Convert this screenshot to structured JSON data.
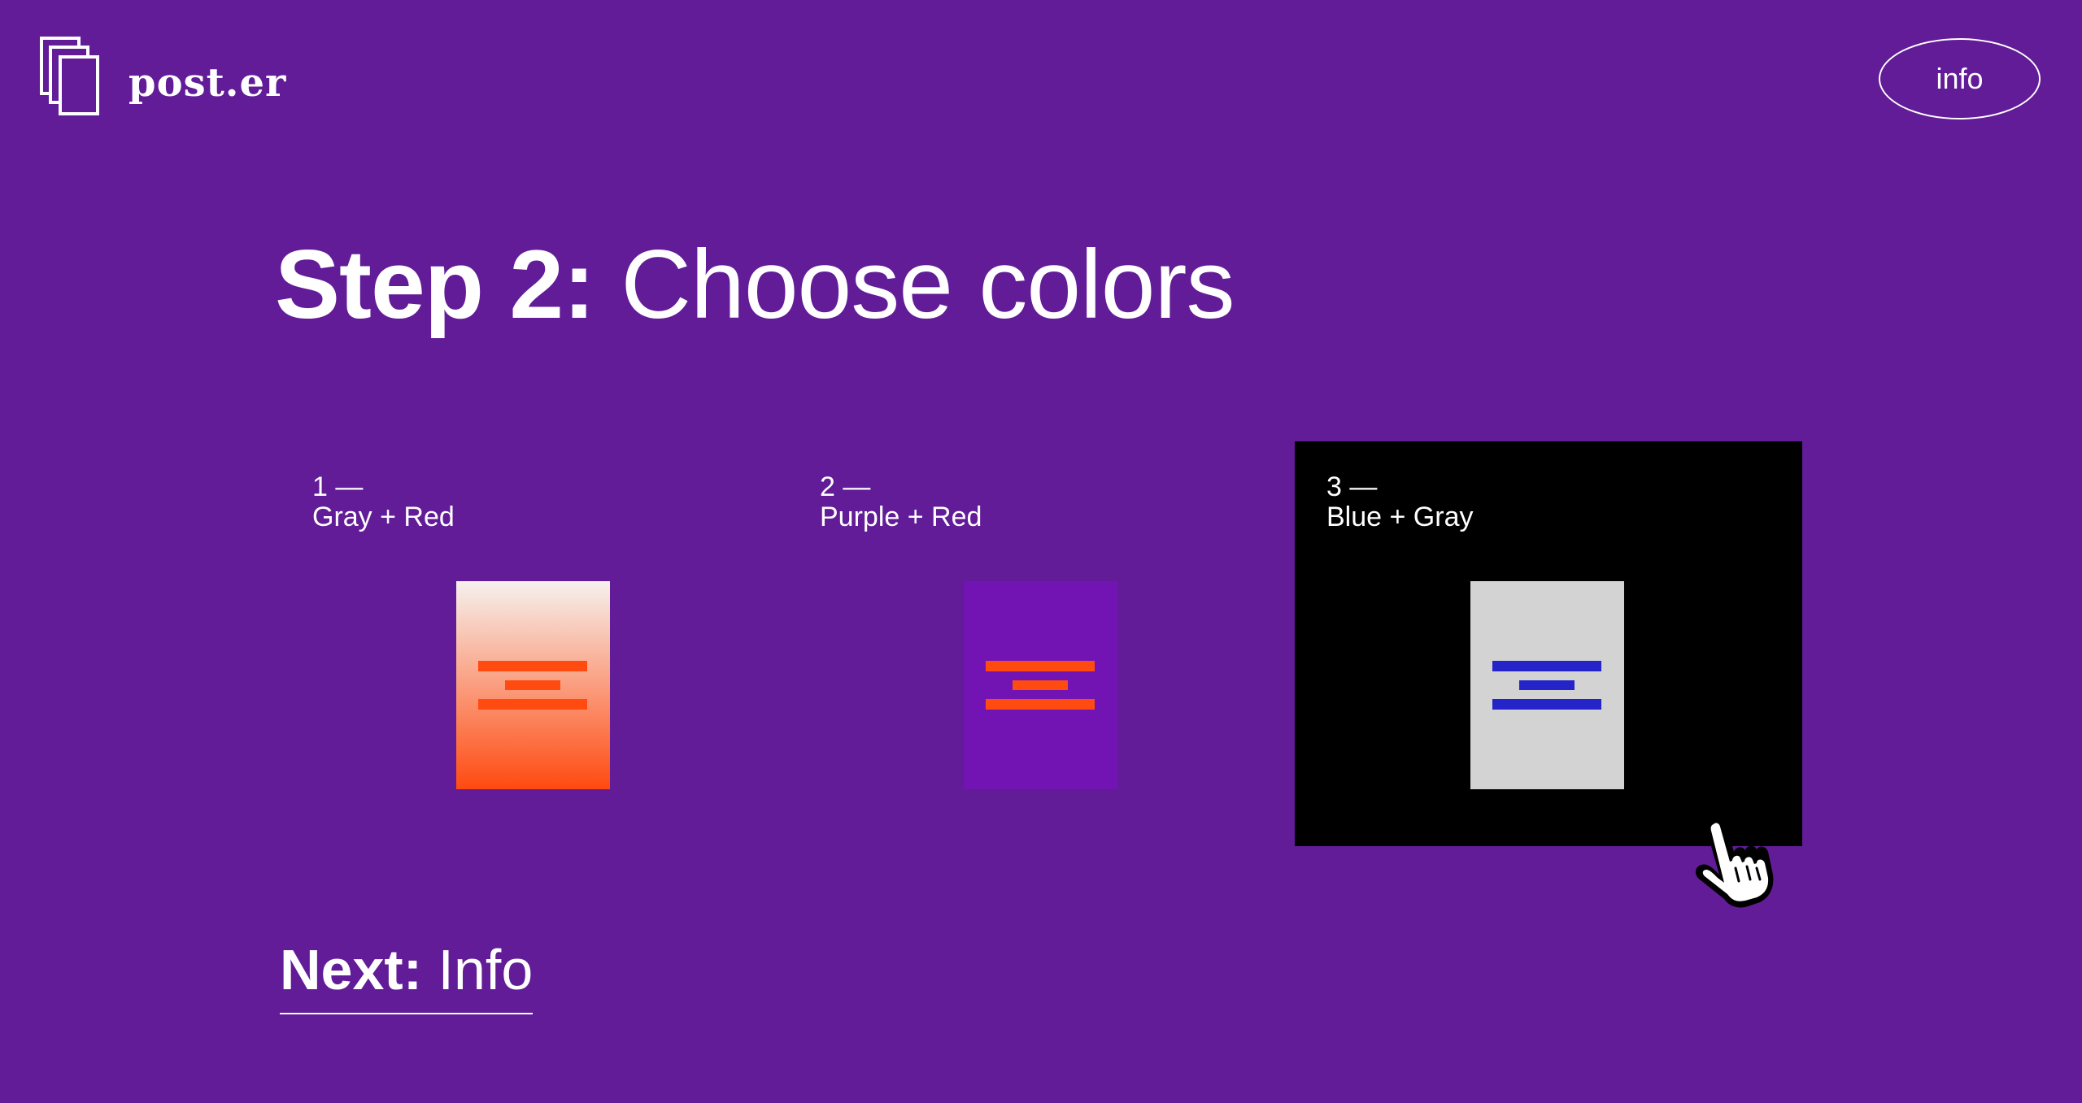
{
  "header": {
    "logo_text": "post.er",
    "info_label": "info"
  },
  "step": {
    "prefix": "Step 2:",
    "title": "Choose colors"
  },
  "options": [
    {
      "number": "1 —",
      "name": "Gray + Red",
      "selected": false,
      "poster_bg": "linear-gradient(#f6f1ee, #ff4a10)",
      "bar_color": "#ff4a10"
    },
    {
      "number": "2 —",
      "name": "Purple + Red",
      "selected": false,
      "poster_bg": "#7214b4",
      "bar_color": "#ff4a10"
    },
    {
      "number": "3 —",
      "name": "Blue + Gray",
      "selected": true,
      "poster_bg": "#d3d3d3",
      "bar_color": "#2424c9"
    }
  ],
  "next": {
    "prefix": "Next:",
    "label": "Info"
  },
  "colors": {
    "background": "#621c97",
    "selected_card": "#000000",
    "text": "#ffffff"
  },
  "cursor_icon": "hand-pointer-icon"
}
